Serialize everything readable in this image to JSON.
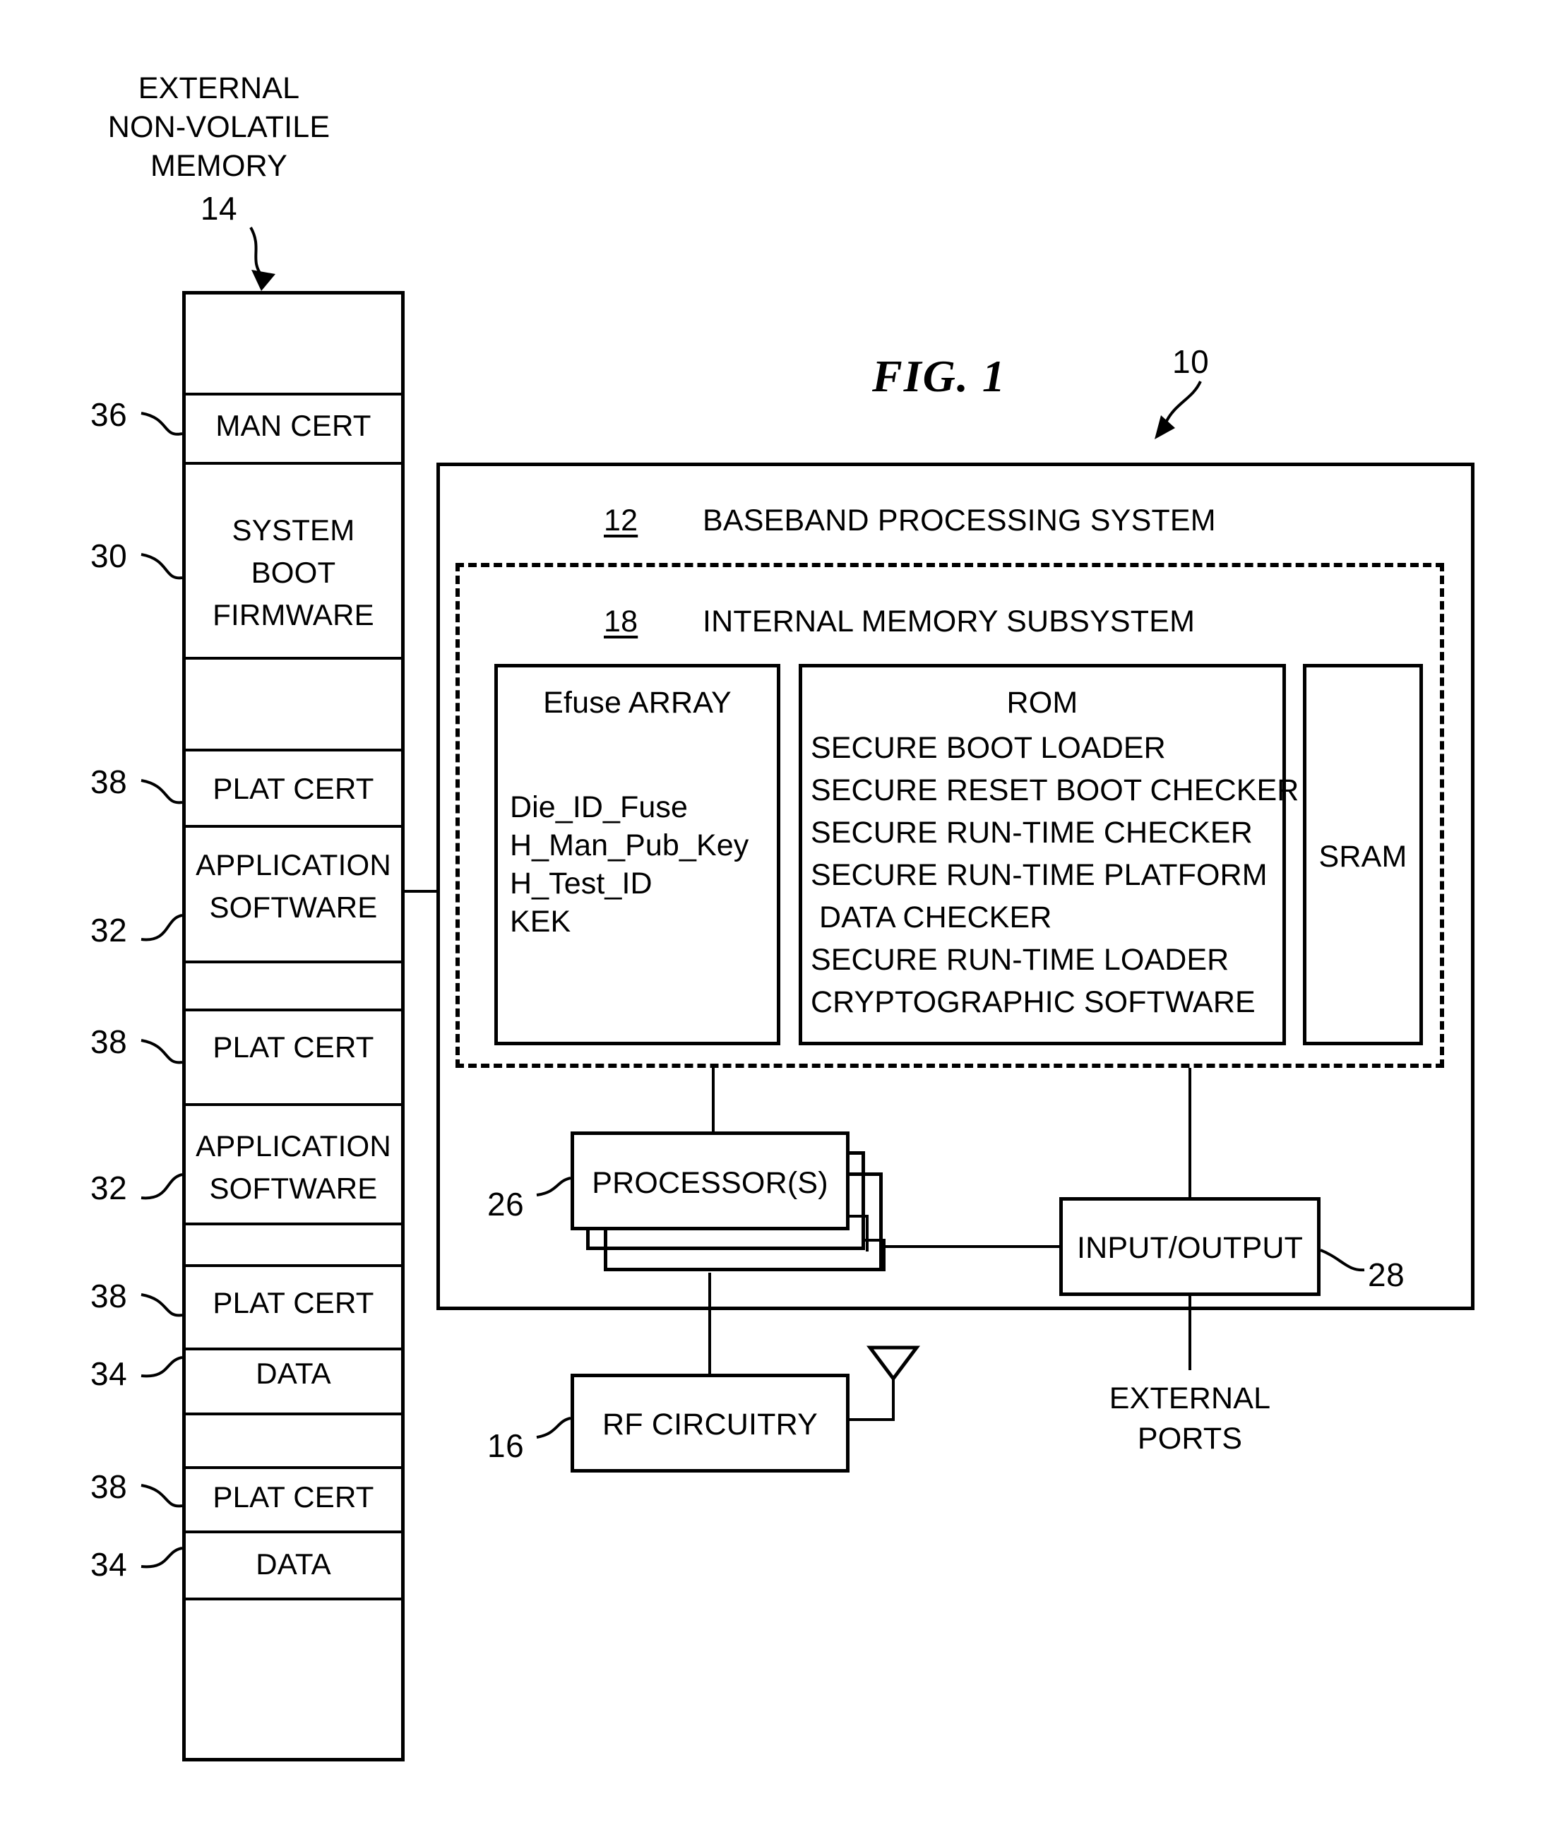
{
  "figure": {
    "title": "FIG. 1",
    "system_ref": "10"
  },
  "external_memory": {
    "title_lines": [
      "EXTERNAL",
      "NON-VOLATILE",
      "MEMORY"
    ],
    "ref": "14",
    "rows": [
      {
        "label": "",
        "ref": "",
        "kind": "blank"
      },
      {
        "label": "MAN CERT",
        "ref": "36",
        "kind": "labeled"
      },
      {
        "label": "SYSTEM\nBOOT\nFIRMWARE",
        "ref": "30",
        "kind": "labeled"
      },
      {
        "label": "",
        "ref": "",
        "kind": "blank"
      },
      {
        "label": "PLAT CERT",
        "ref": "38",
        "kind": "labeled"
      },
      {
        "label": "APPLICATION\nSOFTWARE",
        "ref": "32",
        "kind": "labeled"
      },
      {
        "label": "",
        "ref": "",
        "kind": "blank"
      },
      {
        "label": "PLAT CERT",
        "ref": "38",
        "kind": "labeled"
      },
      {
        "label": "APPLICATION\nSOFTWARE",
        "ref": "32",
        "kind": "labeled"
      },
      {
        "label": "",
        "ref": "",
        "kind": "blank"
      },
      {
        "label": "PLAT CERT",
        "ref": "38",
        "kind": "labeled"
      },
      {
        "label": "DATA",
        "ref": "34",
        "kind": "labeled"
      },
      {
        "label": "PLAT CERT",
        "ref": "38",
        "kind": "labeled"
      },
      {
        "label": "DATA",
        "ref": "34",
        "kind": "labeled"
      },
      {
        "label": "",
        "ref": "",
        "kind": "blank"
      }
    ]
  },
  "baseband": {
    "ref": "12",
    "title": "BASEBAND PROCESSING SYSTEM"
  },
  "internal_memory_subsystem": {
    "ref": "18",
    "title": "INTERNAL MEMORY SUBSYSTEM",
    "efuse": {
      "title": "Efuse ARRAY",
      "entries": [
        "Die_ID_Fuse",
        "H_Man_Pub_Key",
        "H_Test_ID",
        "KEK"
      ]
    },
    "rom": {
      "title": "ROM",
      "entries": [
        "SECURE BOOT LOADER",
        "SECURE RESET BOOT CHECKER",
        "SECURE RUN-TIME CHECKER",
        "SECURE RUN-TIME PLATFORM",
        " DATA CHECKER",
        "SECURE RUN-TIME LOADER",
        "CRYPTOGRAPHIC SOFTWARE"
      ]
    },
    "sram": {
      "title": "SRAM"
    }
  },
  "processor": {
    "label": "PROCESSOR(S)",
    "ref": "26"
  },
  "io": {
    "label": "INPUT/OUTPUT",
    "ref": "28"
  },
  "rf": {
    "label": "RF CIRCUITRY",
    "ref": "16"
  },
  "external_ports": {
    "label_lines": [
      "EXTERNAL",
      "PORTS"
    ]
  },
  "colors": {
    "ink": "#000000",
    "paper": "#ffffff"
  }
}
